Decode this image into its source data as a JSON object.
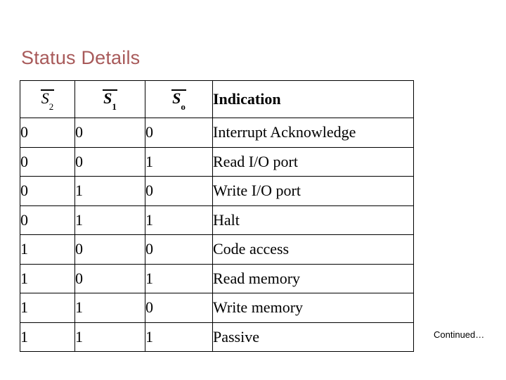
{
  "slide": {
    "title": "Status Details",
    "footnote": "Continued…",
    "title_color": "#a85a5a",
    "background_color": "#ffffff",
    "border_color": "#000000"
  },
  "table": {
    "headers": [
      {
        "symbol": "S",
        "subscript": "2",
        "overline": true,
        "bold": false,
        "name": "s2"
      },
      {
        "symbol": "S",
        "subscript": "1",
        "overline": true,
        "bold": true,
        "name": "s1"
      },
      {
        "symbol": "S",
        "subscript": "o",
        "overline": true,
        "bold": true,
        "name": "s0"
      }
    ],
    "indication_header": "Indication",
    "rows": [
      {
        "s2": "0",
        "s1": "0",
        "s0": "0",
        "indication": "Interrupt Acknowledge"
      },
      {
        "s2": "0",
        "s1": "0",
        "s0": "1",
        "indication": "Read I/O port"
      },
      {
        "s2": "0",
        "s1": "1",
        "s0": "0",
        "indication": "Write I/O port"
      },
      {
        "s2": "0",
        "s1": "1",
        "s0": "1",
        "indication": "Halt"
      },
      {
        "s2": "1",
        "s1": "0",
        "s0": "0",
        "indication": "Code access"
      },
      {
        "s2": "1",
        "s1": "0",
        "s0": "1",
        "indication": "Read memory"
      },
      {
        "s2": "1",
        "s1": "1",
        "s0": "0",
        "indication": "Write memory"
      },
      {
        "s2": "1",
        "s1": "1",
        "s0": "1",
        "indication": "Passive"
      }
    ]
  }
}
